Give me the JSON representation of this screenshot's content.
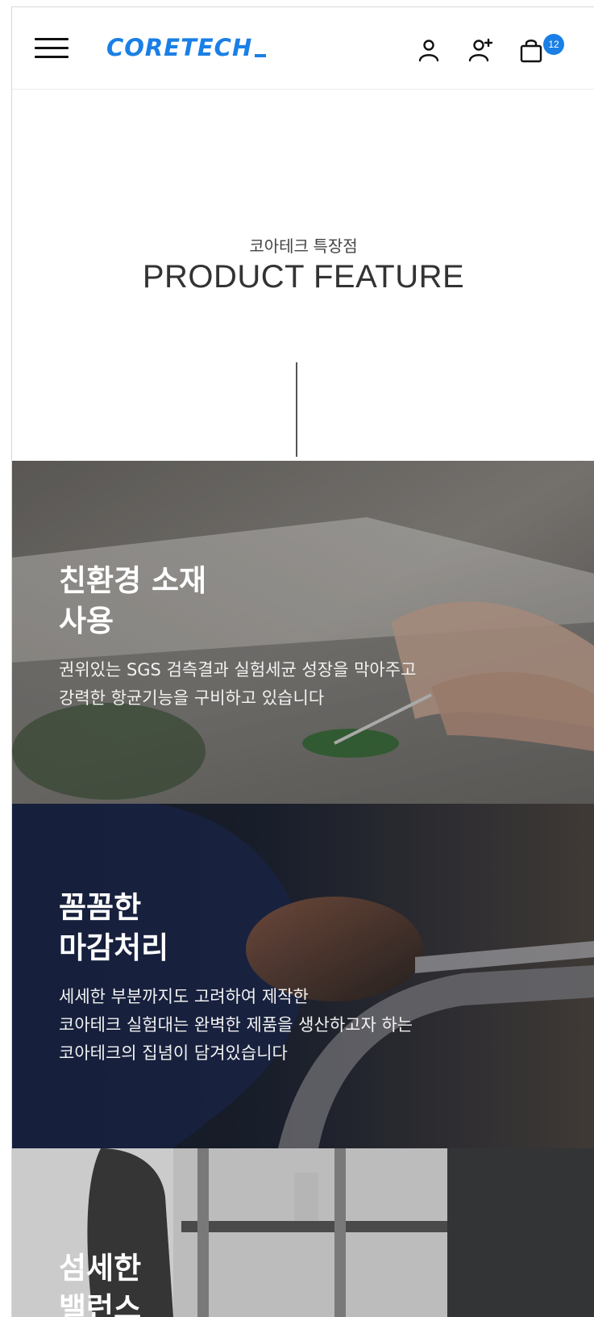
{
  "header": {
    "logo_text": "CORETECH",
    "cart_count": "12",
    "brand_color": "#1a7fe6",
    "icons": [
      "menu-icon",
      "user-icon",
      "user-add-icon",
      "shopping-bag-icon"
    ]
  },
  "intro": {
    "subtitle": "코아테크 특장점",
    "title": "PRODUCT FEATURE"
  },
  "features": [
    {
      "title_line1": "친환경 소재",
      "title_line2": "사용",
      "desc_line1": "권위있는 SGS 검측결과 실험세균 성장을 막아주고",
      "desc_line2": "강력한 항균기능을 구비하고 있습니다"
    },
    {
      "title_line1": "꼼꼼한",
      "title_line2": "마감처리",
      "desc_line1": "세세한 부분까지도 고려하여 제작한",
      "desc_line2": "코아테크 실험대는 완벽한 제품을 생산하고자 하는",
      "desc_line3": "코아테크의 집념이 담겨있습니다"
    },
    {
      "title_line1": "섬세한",
      "title_line2": "밸런스"
    }
  ]
}
